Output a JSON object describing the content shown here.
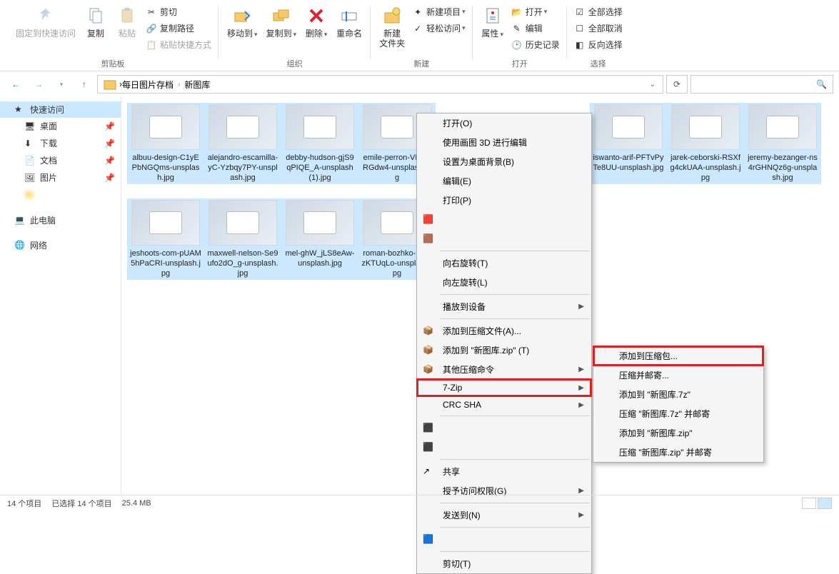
{
  "ribbon": {
    "groups": {
      "clipboard": {
        "label": "剪贴板",
        "pin_quick": "固定到快速访问",
        "copy": "复制",
        "paste": "粘贴",
        "cut": "剪切",
        "copy_path": "复制路径",
        "paste_shortcut": "粘贴快捷方式"
      },
      "organize": {
        "label": "组织",
        "move_to": "移动到",
        "copy_to": "复制到",
        "delete": "删除",
        "rename": "重命名"
      },
      "new": {
        "label": "新建",
        "new_folder": "新建\n文件夹",
        "new_item": "新建项目",
        "easy_access": "轻松访问"
      },
      "open": {
        "label": "打开",
        "properties": "属性",
        "open": "打开",
        "edit": "编辑",
        "history": "历史记录"
      },
      "select": {
        "label": "选择",
        "select_all": "全部选择",
        "select_none": "全部取消",
        "invert": "反向选择"
      }
    }
  },
  "breadcrumb": {
    "seg1": "每日图片存档",
    "seg2": "新图库"
  },
  "sidebar": {
    "quick_access": "快速访问",
    "desktop": "桌面",
    "downloads": "下载",
    "documents": "文档",
    "pictures": "图片",
    "blurred": "　　　",
    "this_pc": "此电脑",
    "network": "网络"
  },
  "files": [
    {
      "name": "albuu-design-C1yEPbNGQms-unsplash.jpg"
    },
    {
      "name": "alejandro-escamilla-yC-Yzbqy7PY-unsplash.jpg"
    },
    {
      "name": "debby-hudson-gjS9qPIQE_A-unsplash(1).jpg"
    },
    {
      "name": "emile-perron-VDYZRGdw4-unsplash.jpg"
    },
    {
      "name": "iswanto-arif-PFTvPyTe8UU-unsplash.jpg"
    },
    {
      "name": "jarek-ceborski-RSXfg4ckUAA-unsplash.jpg"
    },
    {
      "name": "jeremy-bezanger-ns4rGHNQz6g-unsplash.jpg"
    },
    {
      "name": "jeshoots-com-pUAM5hPaCRI-unsplash.jpg"
    },
    {
      "name": "maxwell-nelson-Se9ufo2dO_g-unsplash.jpg"
    },
    {
      "name": "mel-ghW_jLS8eAw-unsplash.jpg"
    },
    {
      "name": "roman-bozhko-PypjzKTUqLo-unsplash.jpg"
    }
  ],
  "context_menu1": {
    "open": "打开(O)",
    "edit_paint3d": "使用画图 3D 进行编辑",
    "set_wallpaper": "设置为桌面背景(B)",
    "edit": "编辑(E)",
    "print": "打印(P)",
    "blur1": "　　　　　　　　",
    "blur2": "　　　　　　",
    "rotate_right": "向右旋转(T)",
    "rotate_left": "向左旋转(L)",
    "cast": "播放到设备",
    "add_archive_a": "添加到压缩文件(A)...",
    "add_zip": "添加到 \"新图库.zip\" (T)",
    "other_compress": "其他压缩命令",
    "sevenzip": "7-Zip",
    "crc_sha": "CRC SHA",
    "blur3": "　　　　　　　　　",
    "blur4": "　　　　　　　　",
    "share": "共享",
    "grant_access": "授予访问权限(G)",
    "send_to": "发送到(N)",
    "blur5": "　　　　　　　　　",
    "cut_truncated": "剪切(T)"
  },
  "context_menu2": {
    "add_archive": "添加到压缩包...",
    "compress_email": "压缩并邮寄...",
    "add_7z": "添加到 \"新图库.7z\"",
    "compress_7z_email": "压缩 \"新图库.7z\" 并邮寄",
    "add_zip": "添加到 \"新图库.zip\"",
    "compress_zip_email": "压缩 \"新图库.zip\" 并邮寄"
  },
  "statusbar": {
    "count": "14 个项目",
    "selected": "已选择 14 个项目",
    "size": "25.4 MB"
  }
}
